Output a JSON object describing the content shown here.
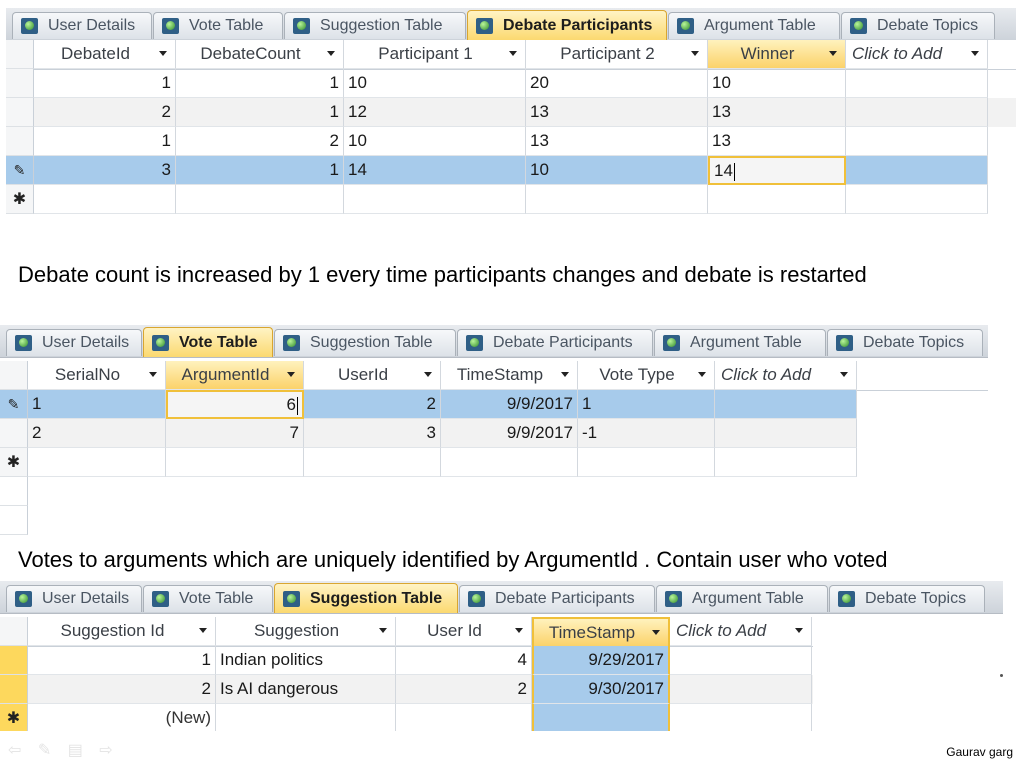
{
  "tabs": [
    "User Details",
    "Vote Table",
    "Suggestion Table",
    "Debate Participants",
    "Argument Table",
    "Debate Topics"
  ],
  "debate_participants": {
    "active_tab": "Debate Participants",
    "columns": [
      "DebateId",
      "DebateCount",
      "Participant 1",
      "Participant 2",
      "Winner",
      "Click to Add"
    ],
    "rows": [
      [
        "1",
        "1",
        "10",
        "20",
        "10",
        ""
      ],
      [
        "2",
        "1",
        "12",
        "13",
        "13",
        ""
      ],
      [
        "1",
        "2",
        "10",
        "13",
        "13",
        ""
      ],
      [
        "3",
        "1",
        "14",
        "10",
        "14",
        ""
      ]
    ]
  },
  "caption1": "Debate count is increased by 1 every time participants changes and debate is restarted",
  "vote_table": {
    "active_tab": "Vote Table",
    "columns": [
      "SerialNo",
      "ArgumentId",
      "UserId",
      "TimeStamp",
      "Vote Type",
      "Click to Add"
    ],
    "rows": [
      [
        "1",
        "6",
        "2",
        "9/9/2017",
        "1",
        ""
      ],
      [
        "2",
        "7",
        "3",
        "9/9/2017",
        "-1",
        ""
      ]
    ]
  },
  "caption2": "Votes to arguments which are uniquely identified by ArgumentId .  Contain user who voted",
  "suggestion_table": {
    "active_tab": "Suggestion Table",
    "columns": [
      "Suggestion Id",
      "Suggestion",
      "User Id",
      "TimeStamp",
      "Click to Add"
    ],
    "rows": [
      [
        "1",
        "Indian politics",
        "4",
        "9/29/2017",
        ""
      ],
      [
        "2",
        "Is AI dangerous",
        "2",
        "9/30/2017",
        ""
      ]
    ],
    "new_row_label": "(New)"
  },
  "author": "Gaurav garg",
  "icons": {
    "tab": "table-icon",
    "row_editing": "pencil-icon",
    "new_row": "asterisk-icon"
  },
  "colors": {
    "active_tab": "#fbd970",
    "selection": "#a7cbeb",
    "focus_border": "#f0c03a"
  }
}
